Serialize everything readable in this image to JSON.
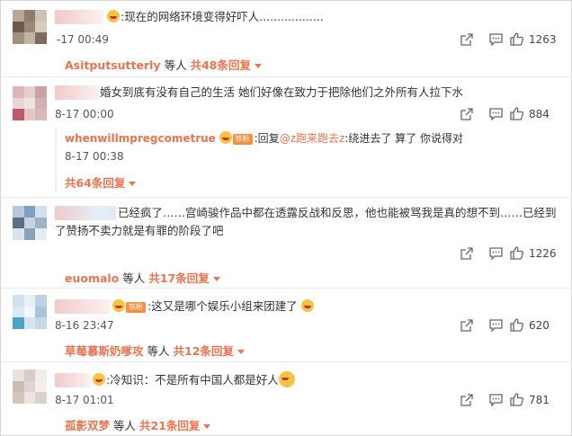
{
  "comments": [
    {
      "text": ":现在的网络环境变得好吓人..................",
      "time": "-17 00:49",
      "likes": "1263",
      "reply_user": "Asitputsutterly",
      "reply_sep": "等人",
      "reply_count": "共48条回复"
    },
    {
      "text": "婚女到底有没有自己的生活 她们好像在致力于把除他们之外所有人拉下水",
      "time": "8-17 00:00",
      "likes": "884",
      "sub": {
        "user": "whenwillmpregcometrue",
        "badge": "铁粉",
        "prefix": ":回复",
        "mention": "@z跑来跑去z",
        "content": ":绕进去了 算了 你说得对",
        "time": "8-17 00:38",
        "count": "共64条回复"
      }
    },
    {
      "text": "已经疯了……宫崎骏作品中都在透露反战和反思，他也能被骂我是真的想不到……已经到了赞扬不卖力就是有罪的阶段了吧",
      "time": "",
      "likes": "1226",
      "reply_user": "euomalo",
      "reply_sep": "等人",
      "reply_count": "共17条回复"
    },
    {
      "badge": "铁粉",
      "text": ":这又是哪个娱乐小组来团建了",
      "time": "8-16 23:47",
      "likes": "620",
      "reply_user": "草莓慕斯奶嗲攻",
      "reply_sep": "等人",
      "reply_count": "共12条回复"
    },
    {
      "text": ":冷知识：不是所有中国人都是好人",
      "time": "8-17 01:01",
      "likes": "781",
      "reply_user": "孤影双梦",
      "reply_sep": "等人",
      "reply_count": "共21条回复"
    }
  ],
  "colors": {
    "accent": "#eb7350",
    "fan_badge": "#ff8b3d",
    "divider": "#ececec"
  },
  "icons": {
    "share": "share-icon",
    "comment": "comment-icon",
    "like": "thumbs-up-icon"
  }
}
